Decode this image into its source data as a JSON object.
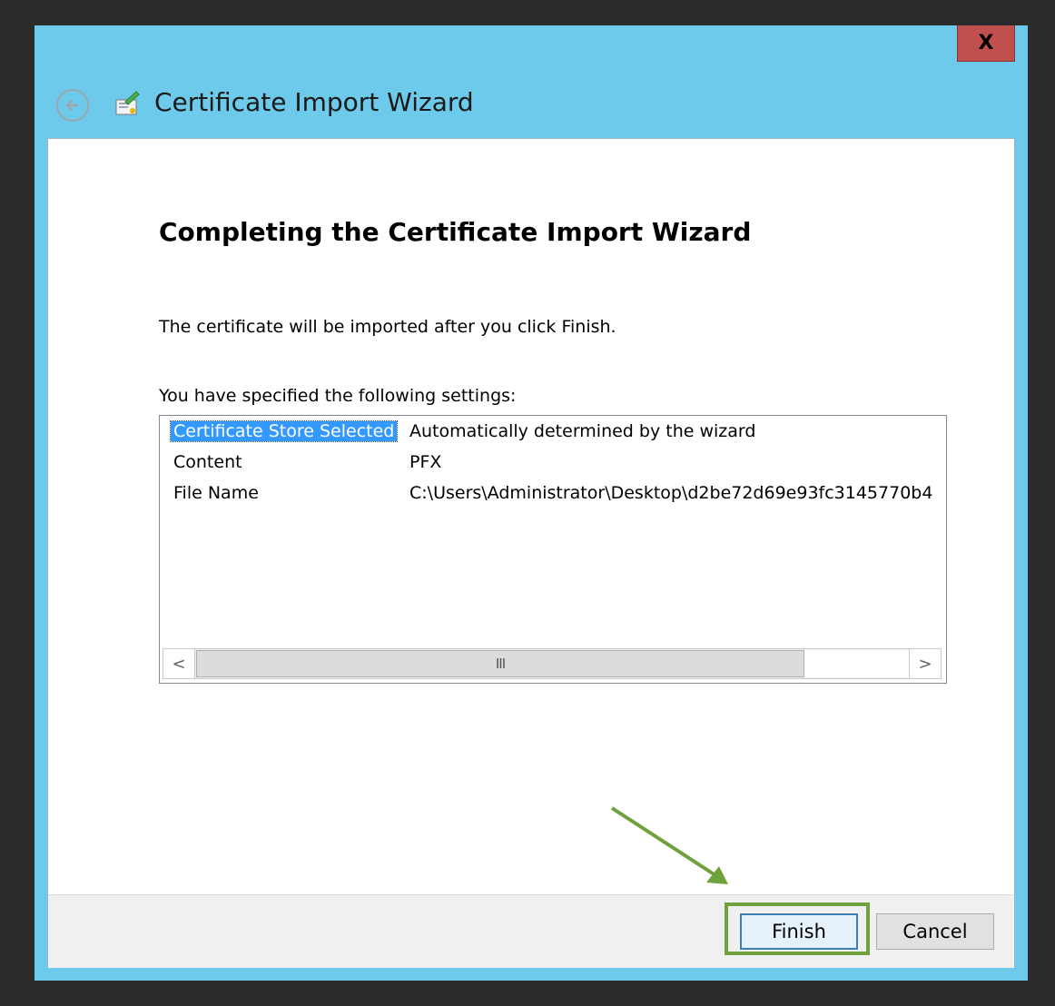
{
  "window": {
    "title": "Certificate Import Wizard",
    "close_label": "X"
  },
  "page": {
    "heading": "Completing the Certificate Import Wizard",
    "info_text": "The certificate will be imported after you click Finish.",
    "settings_label": "You have specified the following settings:"
  },
  "settings": {
    "rows": [
      {
        "key": "Certificate Store Selected",
        "value": "Automatically determined by the wizard",
        "selected": true
      },
      {
        "key": "Content",
        "value": "PFX",
        "selected": false
      },
      {
        "key": "File Name",
        "value": "C:\\Users\\Administrator\\Desktop\\d2be72d69e93fc3145770b4",
        "selected": false
      }
    ]
  },
  "scrollbar": {
    "left_glyph": "<",
    "right_glyph": ">",
    "thumb_glyph": "III"
  },
  "buttons": {
    "finish": "Finish",
    "cancel": "Cancel"
  },
  "icons": {
    "back": "back-arrow-icon",
    "wizard": "certificate-wizard-icon",
    "close": "close-icon"
  },
  "colors": {
    "titlebar": "#6dcaea",
    "close": "#c0504d",
    "selection": "#3399ff",
    "highlight": "#6fa23d"
  }
}
